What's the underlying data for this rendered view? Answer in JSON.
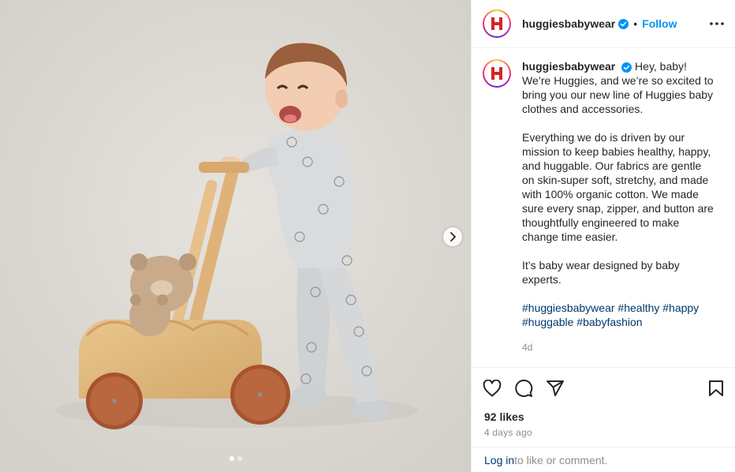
{
  "post": {
    "username": "huggiesbabywear",
    "separator": "•",
    "follow_label": "Follow",
    "caption": {
      "p1": "Hey, baby! We’re Huggies, and we’re so excited to bring you our new line of Huggies baby clothes and accessories.",
      "p2": "Everything we do is driven by our mission to keep babies healthy, happy, and huggable. Our fabrics are gentle on skin-super soft, stretchy, and made with 100% organic cotton. We made sure every snap, zipper, and button are thoughtfully engineered to make change time easier.",
      "p3": "It’s baby wear designed by baby experts.",
      "hashtags": [
        "#huggiesbabywear",
        "#healthy",
        "#happy",
        "#huggable",
        "#babyfashion"
      ]
    },
    "caption_age": "4d",
    "likes": "92 likes",
    "posted_ago": "4 days ago",
    "comment": {
      "login_label": "Log in",
      "rest": " to like or comment."
    },
    "carousel": {
      "current": 1,
      "total": 2
    }
  },
  "icons": {
    "verified": "verified-badge-icon",
    "more": "more-options-icon",
    "like": "heart-icon",
    "comment": "comment-icon",
    "share": "share-icon",
    "save": "bookmark-icon",
    "next": "chevron-right-icon"
  },
  "colors": {
    "accent": "#0095f6",
    "hashtag": "#00376b",
    "brand_red": "#d8232a",
    "muted": "#8e8e8e"
  }
}
